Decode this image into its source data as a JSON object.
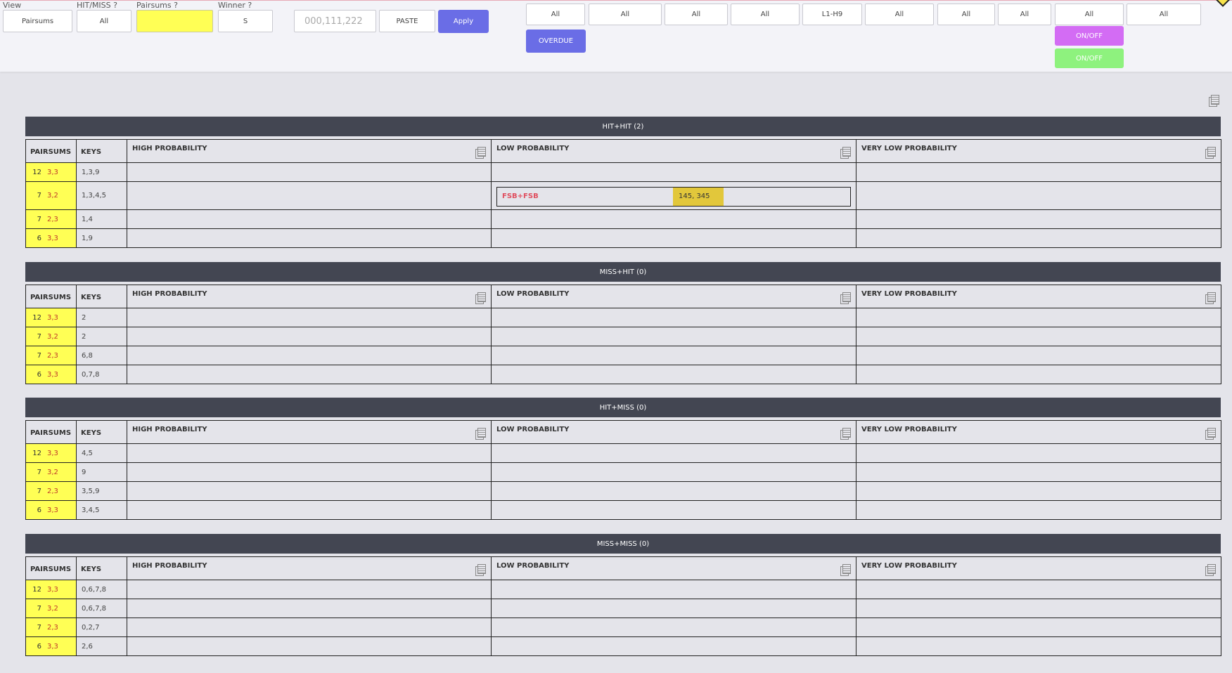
{
  "filters": {
    "view": {
      "label": "View",
      "value": "Pairsums"
    },
    "hitmiss": {
      "label": "HIT/MISS ?",
      "value": "All"
    },
    "pairsums": {
      "label": "Pairsums ?",
      "value": ""
    },
    "winner": {
      "label": "Winner ?",
      "value": "S"
    },
    "number_input": {
      "placeholder": "000,111,222"
    },
    "paste_label": "PASTE",
    "apply_label": "Apply"
  },
  "column_filters": [
    "All",
    "All",
    "All",
    "All",
    "L1-H9",
    "All",
    "All",
    "All",
    "All",
    "All"
  ],
  "buttons": {
    "overdue": "OVERDUE",
    "onoff_purple": "ON/OFF",
    "onoff_green": "ON/OFF"
  },
  "colors": {
    "accent": "#6a6de6",
    "yellow": "#ffff55",
    "header_dark": "#434652",
    "purple": "#d36cf4",
    "green": "#8ef27e",
    "red_text": "#e04f5f",
    "gold": "#e2c73b"
  },
  "columns": {
    "pairsums": "PAIRSUMS",
    "keys": "KEYS",
    "high": "HIGH PROBABILITY",
    "low": "LOW PROBABILITY",
    "very_low": "VERY LOW PROBABILITY"
  },
  "sections": [
    {
      "title": "HIT+HIT (2)",
      "rows": [
        {
          "sum": "12",
          "pair": "3,3",
          "keys": "1,3,9"
        },
        {
          "sum": "7",
          "pair": "3,2",
          "keys": "1,3,4,5"
        },
        {
          "sum": "7",
          "pair": "2,3",
          "keys": "1,4"
        },
        {
          "sum": "6",
          "pair": "3,3",
          "keys": "1,9"
        }
      ]
    },
    {
      "title": "MISS+HIT (0)",
      "rows": [
        {
          "sum": "12",
          "pair": "3,3",
          "keys": "2"
        },
        {
          "sum": "7",
          "pair": "3,2",
          "keys": "2"
        },
        {
          "sum": "7",
          "pair": "2,3",
          "keys": "6,8"
        },
        {
          "sum": "6",
          "pair": "3,3",
          "keys": "0,7,8"
        }
      ]
    },
    {
      "title": "HIT+MISS (0)",
      "rows": [
        {
          "sum": "12",
          "pair": "3,3",
          "keys": "4,5"
        },
        {
          "sum": "7",
          "pair": "3,2",
          "keys": "9"
        },
        {
          "sum": "7",
          "pair": "2,3",
          "keys": "3,5,9"
        },
        {
          "sum": "6",
          "pair": "3,3",
          "keys": "3,4,5"
        }
      ]
    },
    {
      "title": "MISS+MISS (0)",
      "rows": [
        {
          "sum": "12",
          "pair": "3,3",
          "keys": "0,6,7,8"
        },
        {
          "sum": "7",
          "pair": "3,2",
          "keys": "0,6,7,8"
        },
        {
          "sum": "7",
          "pair": "2,3",
          "keys": "0,2,7"
        },
        {
          "sum": "6",
          "pair": "3,3",
          "keys": "2,6"
        }
      ]
    }
  ],
  "highlight": {
    "label": "FSB+FSB",
    "value": "145, 345"
  }
}
